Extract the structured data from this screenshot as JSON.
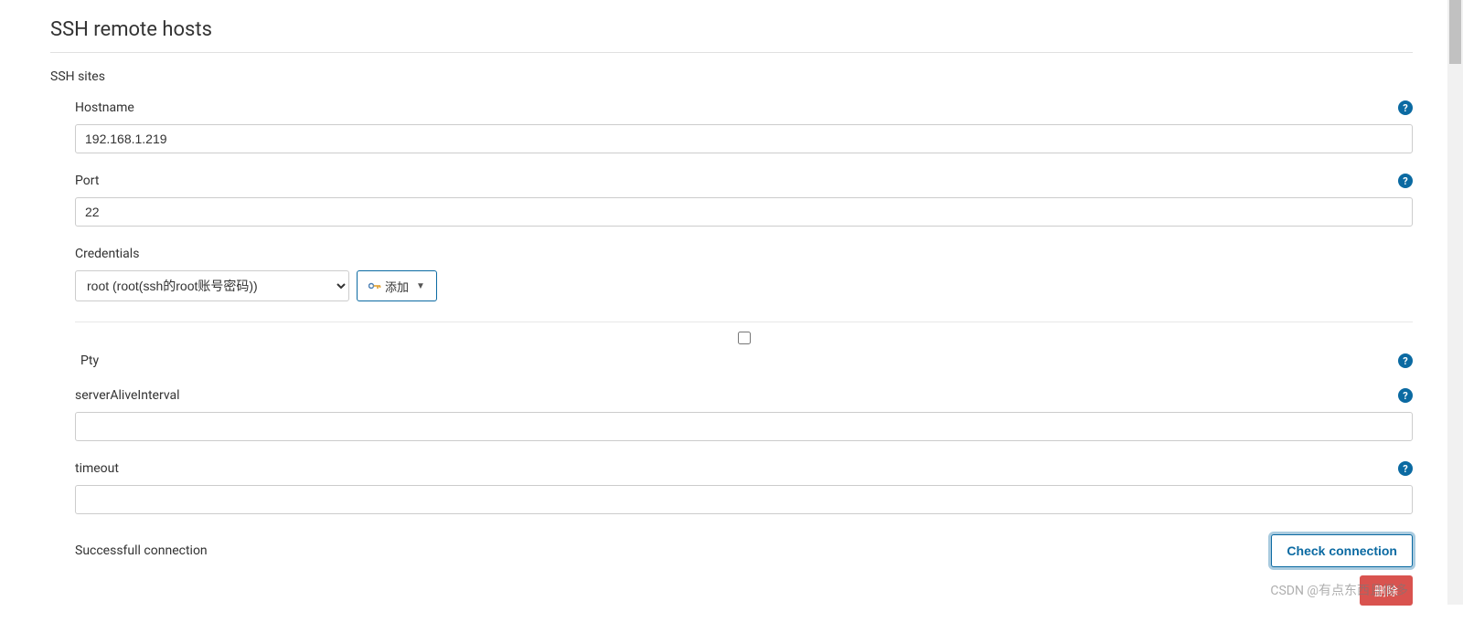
{
  "section": {
    "title": "SSH remote hosts",
    "subsection": "SSH sites"
  },
  "fields": {
    "hostname": {
      "label": "Hostname",
      "value": "192.168.1.219"
    },
    "port": {
      "label": "Port",
      "value": "22"
    },
    "credentials": {
      "label": "Credentials",
      "selected": "root (root(ssh的root账号密码))",
      "add_label": "添加"
    },
    "pty": {
      "label": "Pty",
      "checked": false
    },
    "serverAliveInterval": {
      "label": "serverAliveInterval",
      "value": ""
    },
    "timeout": {
      "label": "timeout",
      "value": ""
    }
  },
  "status": {
    "message": "Successfull connection",
    "check_button": "Check connection"
  },
  "buttons": {
    "delete": "删除"
  },
  "watermark": "CSDN @有点东西且很多",
  "help_glyph": "?"
}
